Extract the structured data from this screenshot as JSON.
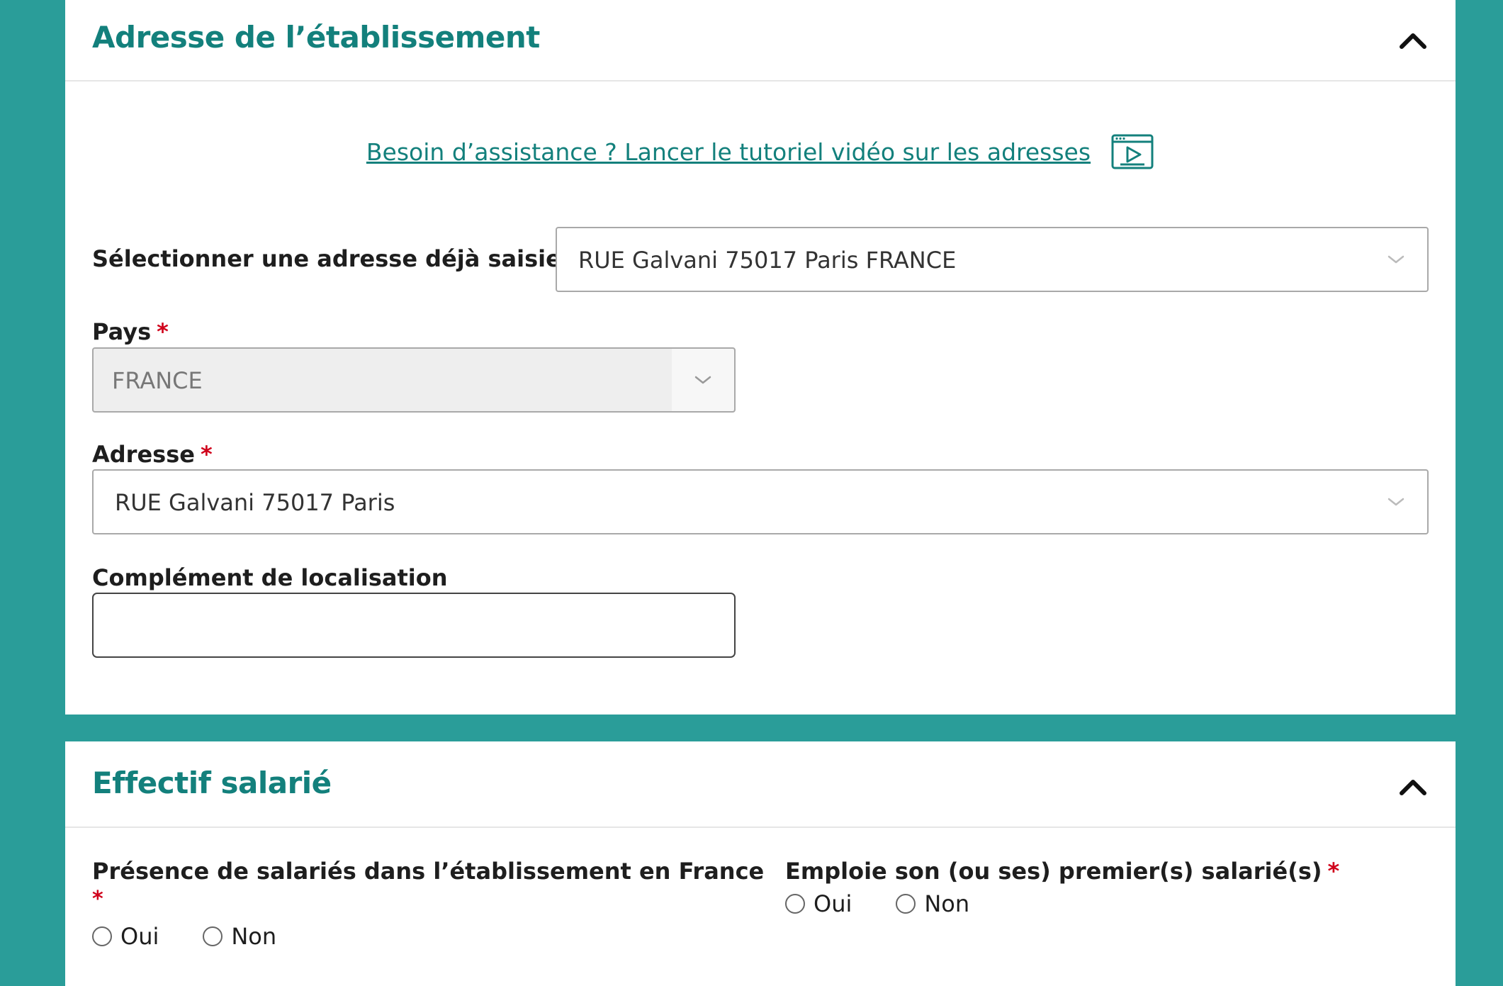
{
  "address_section": {
    "title": "Adresse de l’établissement",
    "help_link": "Besoin d’assistance ? Lancer le tutoriel vidéo sur les adresses",
    "saved_address": {
      "label": "Sélectionner une adresse déjà saisie :",
      "value": "RUE Galvani 75017 Paris FRANCE"
    },
    "country": {
      "label": "Pays",
      "required_mark": "*",
      "value": "FRANCE"
    },
    "address": {
      "label": "Adresse",
      "required_mark": "*",
      "value": "RUE Galvani 75017 Paris"
    },
    "complement": {
      "label": "Complément de localisation",
      "value": ""
    }
  },
  "staff_section": {
    "title": "Effectif salarié",
    "presence": {
      "label": "Présence de salariés dans l’établissement en France",
      "required_mark": "*",
      "options": [
        "Oui",
        "Non"
      ]
    },
    "first_employee": {
      "label": "Emploie son (ou ses) premier(s) salarié(s)",
      "required_mark": "*",
      "options": [
        "Oui",
        "Non"
      ]
    }
  },
  "colors": {
    "background": "#2a9d99",
    "accent": "#13807c",
    "required": "#d0021b"
  }
}
